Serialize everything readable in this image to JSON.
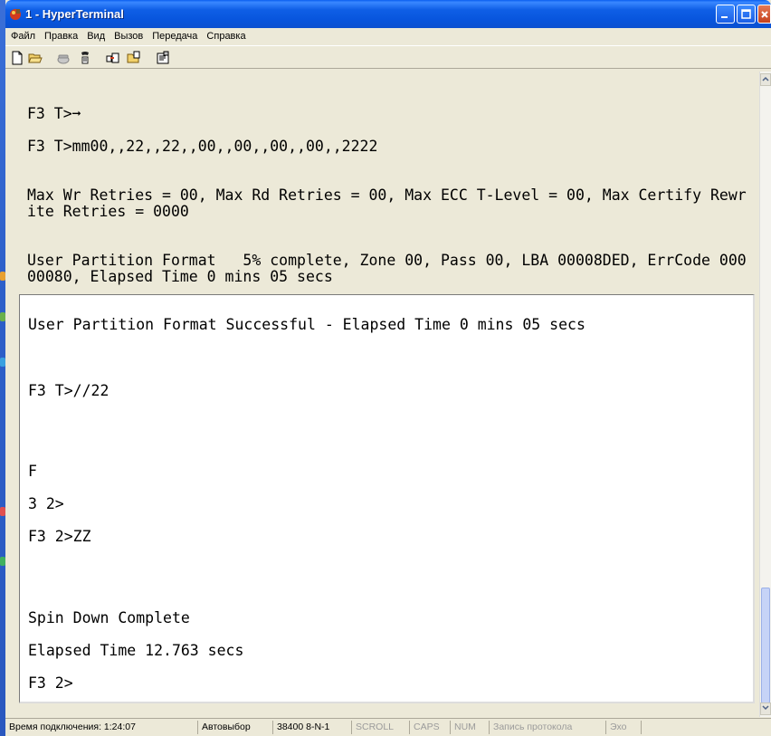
{
  "window": {
    "title": "1 - HyperTerminal"
  },
  "menu": {
    "items": [
      "Файл",
      "Правка",
      "Вид",
      "Вызов",
      "Передача",
      "Справка"
    ]
  },
  "toolbar": {
    "icons": [
      "new-document-icon",
      "open-folder-icon",
      "connect-phone-icon",
      "disconnect-phone-icon",
      "send-icon",
      "receive-icon",
      "properties-icon"
    ]
  },
  "terminal": {
    "scrollback_lines": [
      "F3 T>➞",
      "F3 T>mm00,,22,,22,,00,,00,,00,,00,,2222",
      "Max Wr Retries = 00, Max Rd Retries = 00, Max ECC T-Level = 00, Max Certify Rewr",
      "ite Retries = 0000",
      "User Partition Format   5% complete, Zone 00, Pass 00, LBA 00008DED, ErrCode 000",
      "00080, Elapsed Time 0 mins 05 secs"
    ],
    "screen_lines": [
      "User Partition Format Successful - Elapsed Time 0 mins 05 secs",
      "F3 T>//22",
      "F",
      "3 2>",
      "F3 2>ZZ",
      "Spin Down Complete",
      "Elapsed Time 12.763 secs",
      "F3 2>"
    ]
  },
  "statusbar": {
    "connection_time": "Время подключения: 1:24:07",
    "detect": "Автовыбор",
    "port_settings": "38400 8-N-1",
    "scroll": "SCROLL",
    "caps": "CAPS",
    "num": "NUM",
    "capture": "Запись протокола",
    "echo": "Эхо"
  },
  "colors": {
    "titlebar": "#0a55dd",
    "chrome": "#ECE9D8",
    "screen_bg": "#ffffff"
  }
}
